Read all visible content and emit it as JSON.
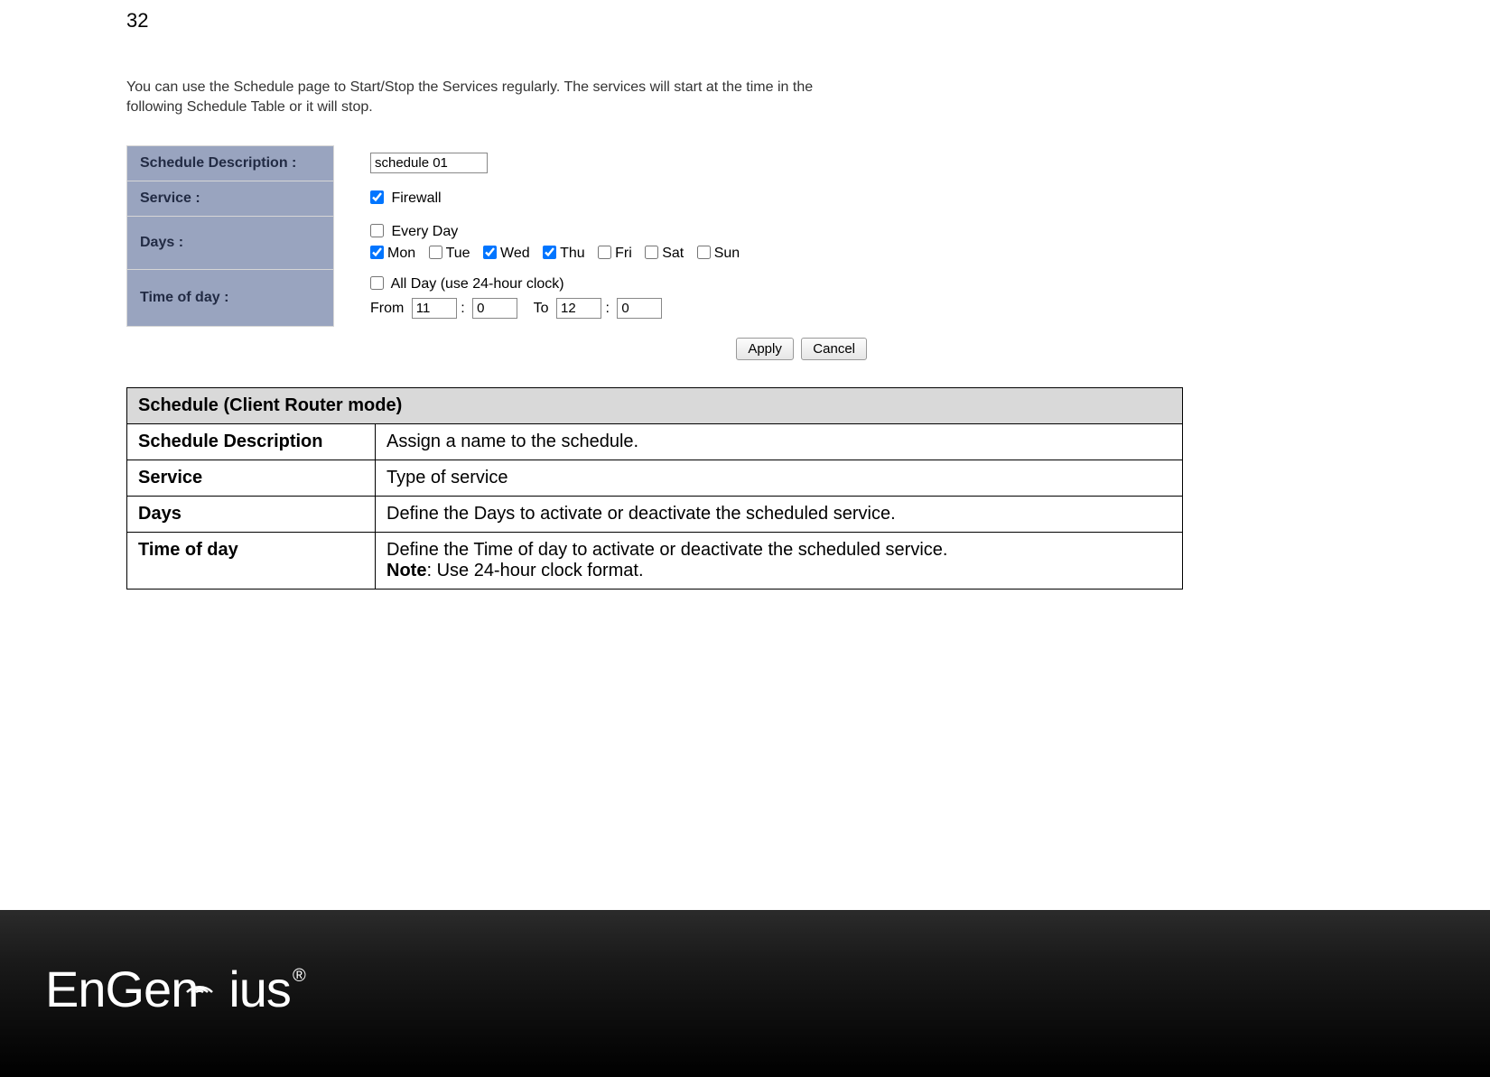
{
  "page_number": "32",
  "intro": "You can use the Schedule page to Start/Stop the Services regularly. The services will start at the time in the following Schedule Table or it will stop.",
  "form": {
    "schedule_description_label": "Schedule Description :",
    "schedule_description_value": "schedule 01",
    "service_label": "Service :",
    "service_firewall": "Firewall",
    "days_label": "Days :",
    "every_day": "Every Day",
    "mon": "Mon",
    "tue": "Tue",
    "wed": "Wed",
    "thu": "Thu",
    "fri": "Fri",
    "sat": "Sat",
    "sun": "Sun",
    "time_label": "Time of day :",
    "all_day": "All Day (use 24-hour clock)",
    "from": "From",
    "to": "To",
    "from_h": "11",
    "from_m": "0",
    "to_h": "12",
    "to_m": "0",
    "apply": "Apply",
    "cancel": "Cancel"
  },
  "doc": {
    "title": "Schedule (Client Router mode)",
    "rows": [
      {
        "k": "Schedule Description",
        "v": "Assign a name to the schedule."
      },
      {
        "k": "Service",
        "v": "Type of service"
      },
      {
        "k": "Days",
        "v": "Define the Days to activate or deactivate the scheduled service."
      },
      {
        "k": "Time of day",
        "v_main": "Define the Time of day to activate or deactivate the scheduled service.",
        "v_note_label": "Note",
        "v_note": ": Use 24-hour clock format."
      }
    ]
  },
  "logo_text": "EnGenius"
}
